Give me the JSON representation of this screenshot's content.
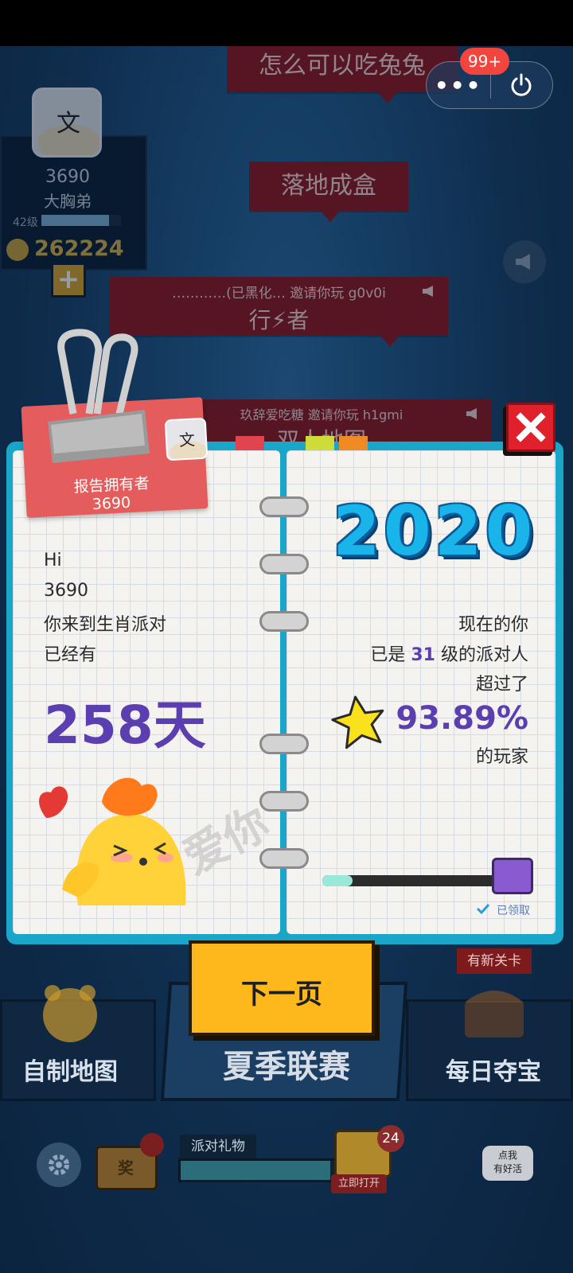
{
  "status_badge": "99+",
  "capsule": {
    "more_icon": "more-icon",
    "power_icon": "power-icon"
  },
  "banners": [
    {
      "text": "怎么可以吃兔兔"
    },
    {
      "text": "落地成盒"
    },
    {
      "small": "…………(已黑化… 邀请你玩 g0v0i",
      "big": "行⚡者"
    },
    {
      "small": "玖辞爱吃糖 邀请你玩 h1gmi",
      "big": "双人地图"
    }
  ],
  "player": {
    "id": "3690",
    "name": "大胸弟",
    "level": "42级",
    "level_progress": 0.85,
    "coins": "262224"
  },
  "report": {
    "owner_label": "报告拥有者",
    "owner_id": "3690",
    "greeting": "Hi",
    "user_id": "3690",
    "line1": "你来到生肖派对",
    "line2": "已经有",
    "days": "258天",
    "love_watermark": "爱你",
    "year": "2020",
    "now_you": "现在的你",
    "level_prefix": "已是",
    "level_value": "31",
    "level_suffix": "级的派对人",
    "surpass": "超过了",
    "percent": "93.89%",
    "players": "的玩家",
    "progress": 0.17,
    "claimed": "已领取"
  },
  "bottom": {
    "next_page": "下一页",
    "custom_map": "自制地图",
    "summer_league": "夏季联赛",
    "daily_treasure": "每日夺宝",
    "new_card": "有新关卡",
    "prize_tv": "奖",
    "party_gift": "派对礼物",
    "gift_progress": 0.92,
    "gift_count": "24",
    "open_now": "立即打开",
    "click_me_line1": "点我",
    "click_me_line2": "有好活"
  },
  "colors": {
    "accent_purple": "#5b3fb0",
    "close_red": "#e0202b",
    "next_yellow": "#ffb81c",
    "year_blue": "#19b4ea"
  }
}
